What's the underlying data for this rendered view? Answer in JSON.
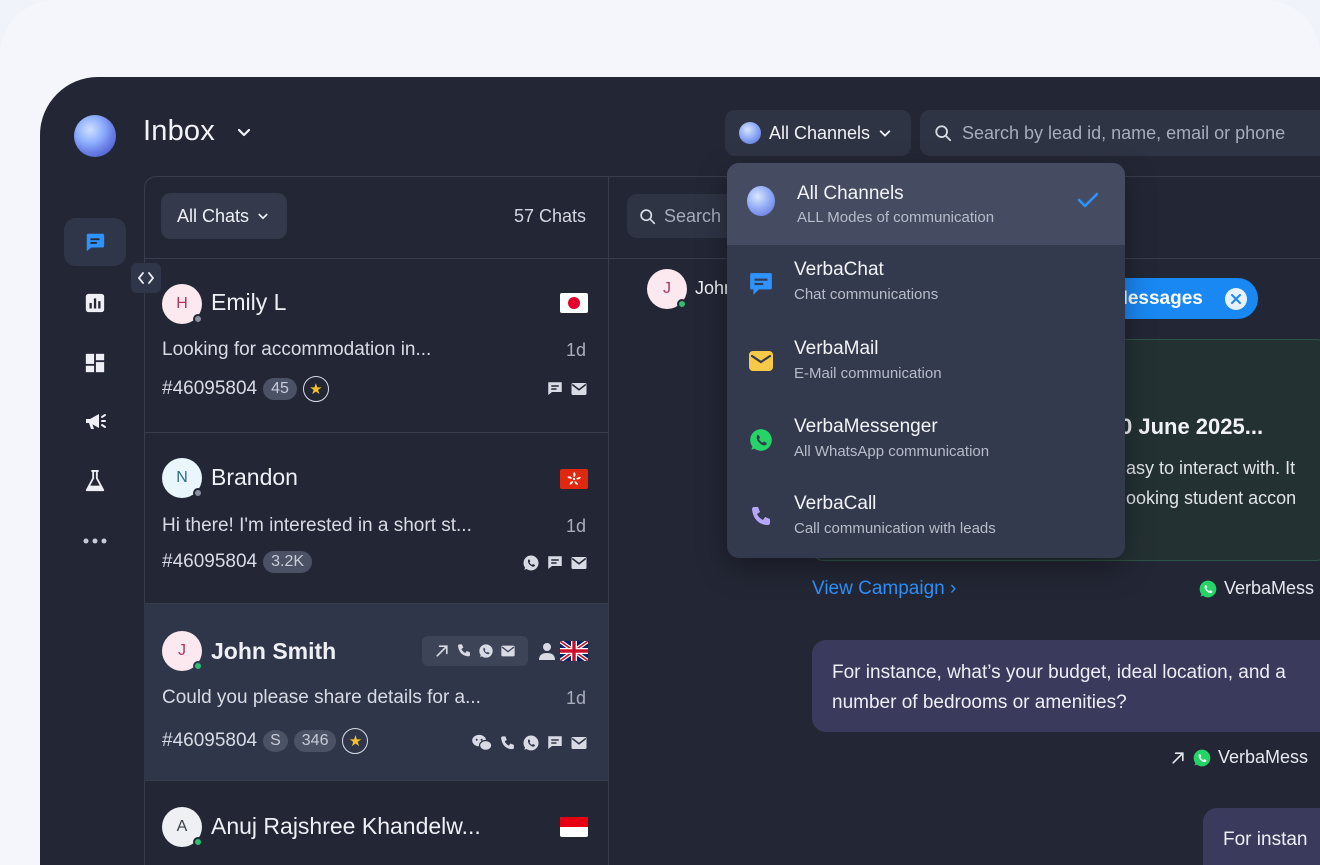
{
  "header": {
    "title": "Inbox",
    "channel_button": "All Channels",
    "search_placeholder": "Search by lead id, name, email or phone"
  },
  "list": {
    "filter_label": "All Chats",
    "count_label": "57 Chats",
    "rows": [
      {
        "initial": "H",
        "name": "Emily L",
        "preview": "Looking for accommodation in...",
        "time": "1d",
        "lead_id": "#46095804",
        "badge": "45"
      },
      {
        "initial": "N",
        "name": "Brandon",
        "preview": "Hi there! I'm interested in a short st...",
        "time": "1d",
        "lead_id": "#46095804",
        "badge": "3.2K"
      },
      {
        "initial": "J",
        "name": "John Smith",
        "preview": "Could you please share details for a...",
        "time": "1d",
        "lead_id": "#46095804",
        "tag": "S",
        "badge": "346"
      },
      {
        "initial": "A",
        "name": "Anuj Rajshree Khandelw..."
      }
    ]
  },
  "conversation": {
    "search_placeholder": "Search",
    "contact_initial": "J",
    "contact_name": "John",
    "filter_chip": "Messages",
    "campaign_title": "0 June 2025...",
    "campaign_line1": "asy to interact with. It",
    "campaign_line2": "ooking student accon",
    "view_campaign": "View Campaign",
    "source_1": "VerbaMess",
    "message_1": "For instance, what’s your budget, ideal location, and a number of bedrooms or amenities?",
    "source_2": "VerbaMess",
    "message_2": "For instan"
  },
  "dropdown": {
    "items": [
      {
        "title": "All Channels",
        "subtitle": "ALL Modes of communication",
        "selected": true
      },
      {
        "title": "VerbaChat",
        "subtitle": "Chat communications"
      },
      {
        "title": "VerbaMail",
        "subtitle": "E-Mail communication"
      },
      {
        "title": "VerbaMessenger",
        "subtitle": "All WhatsApp communication"
      },
      {
        "title": "VerbaCall",
        "subtitle": "Call communication with leads"
      }
    ]
  },
  "colors": {
    "background": "#232735",
    "accent": "#1a88f2",
    "whatsapp": "#25d366",
    "mail": "#f7c948",
    "call": "#b7a6ff"
  }
}
